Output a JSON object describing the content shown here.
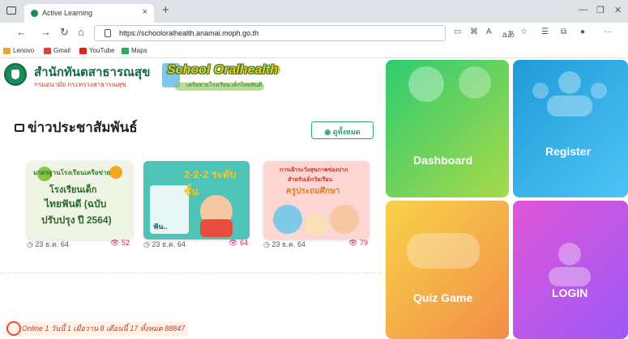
{
  "browser": {
    "tab_title": "Active Learning",
    "tab_close": "×",
    "new_tab": "+",
    "url": "https://schooloralhealth.anamai.moph.go.th",
    "bookmarks": [
      {
        "label": "Lenovo",
        "color": "#e8a33d"
      },
      {
        "label": "Gmail",
        "color": "#d44638"
      },
      {
        "label": "YouTube",
        "color": "#e62117"
      },
      {
        "label": "Maps",
        "color": "#34a853"
      }
    ]
  },
  "header": {
    "org_name": "สำนักทันตสาธารณสุข",
    "org_dept": "กรมอนามัย กระทรวงสาธารณสุข",
    "school_title": "School Oralhealth",
    "school_sub": "เครือข่ายโรงเรียน เด็กไทยฟันดี"
  },
  "news": {
    "heading": "ข่าวประชาสัมพันธ์",
    "all_button": "ดูทั้งหมด",
    "cards": [
      {
        "line1": "มาตรฐานโรงเรียนเครือข่าย",
        "line2": "โรงเรียนเด็ก",
        "line3": "ไทยฟันดี (ฉบับ",
        "line4": "ปรับปรุง ปี 2564)",
        "date": "23 ธ.ค. 64",
        "views": "52"
      },
      {
        "line1": "2-2-2 ระดับชั้น",
        "line2": "ฟัน..",
        "date": "23 ธ.ค. 64",
        "views": "64"
      },
      {
        "line1": "การเฝ้าระวังสุขภาพช่องปาก",
        "line2": "สำหรับเด็กวัยเรียน",
        "line3": "ครูประถมศึกษา",
        "date": "23 ธ.ค. 64",
        "views": "79"
      }
    ]
  },
  "footer": {
    "stats": "Online 1  วันนี้ 1  เมื่อวาน 8  เดือนนี้ 17  ทั้งหมด 88847"
  },
  "tiles": {
    "dashboard": "Dashboard",
    "register": "Register",
    "quiz": "Quiz Game",
    "login": "LOGIN"
  }
}
